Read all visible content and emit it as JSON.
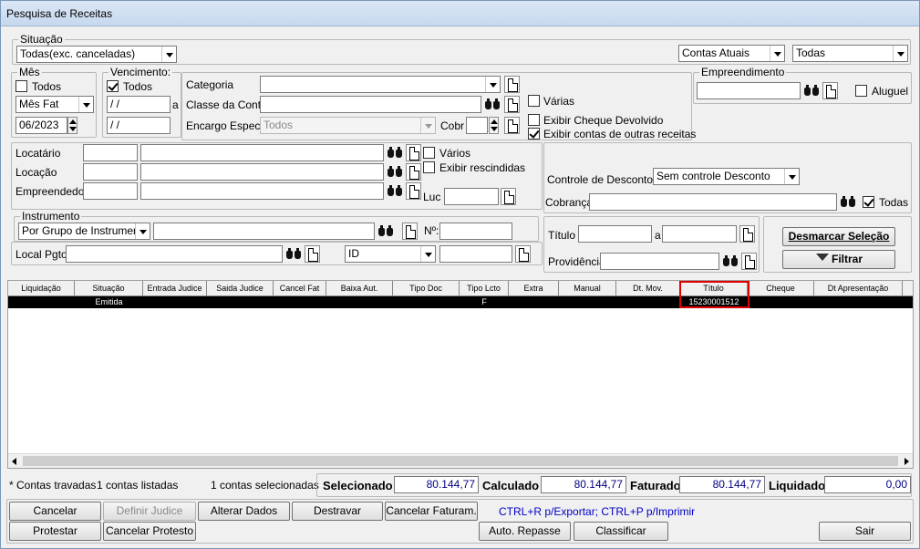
{
  "window": {
    "title": "Pesquisa de Receitas"
  },
  "situacao": {
    "legend": "Situação",
    "value": "Todas(exc. canceladas)"
  },
  "contas": {
    "value": "Contas Atuais"
  },
  "todas_combo": {
    "value": "Todas"
  },
  "mes": {
    "legend": "Mês",
    "todos_label": "Todos",
    "todos_checked": false,
    "tipo": "Mês Fat",
    "periodo": "06/2023"
  },
  "vencimento": {
    "legend": "Vencimento:",
    "todos_label": "Todos",
    "todos_checked": true,
    "de": " / /",
    "sep": "a",
    "ate": " / /"
  },
  "categoria": {
    "label": "Categoria",
    "value": ""
  },
  "classe": {
    "label": "Classe da Conta",
    "value": ""
  },
  "encargo": {
    "label": "Encargo Espec.",
    "value": "Todos"
  },
  "cobr": {
    "label": "Cobr",
    "value": ""
  },
  "opcoes": {
    "varias": "Várias",
    "cheque_devolvido": "Exibir Cheque Devolvido",
    "outras_receitas": "Exibir contas de outras receitas",
    "outras_receitas_checked": true
  },
  "empreendimento": {
    "legend": "Empreendimento",
    "value": "",
    "aluguel": "Aluguel"
  },
  "filtros": {
    "locatario": "Locatário",
    "locacao": "Locação",
    "empreendedor": "Empreendedor",
    "varios": "Vários",
    "rescindidas": "Exibir rescindidas",
    "luc": "Luc"
  },
  "descontos": {
    "label": "Controle de Descontos",
    "value": "Sem controle Desconto"
  },
  "cobranca": {
    "label": "Cobrança",
    "value": "",
    "todas": "Todas",
    "todas_checked": true
  },
  "instrumento": {
    "legend": "Instrumento",
    "value": "Por Grupo de Instrumento",
    "numero_label": "Nº:"
  },
  "local_pgto": {
    "label": "Local Pgto",
    "id_value": "ID"
  },
  "titulo": {
    "label": "Título",
    "sep": "a"
  },
  "providencia": {
    "label": "Providência"
  },
  "buttons": {
    "desmarcar": "Desmarcar Seleção",
    "filtrar": "Filtrar"
  },
  "grid": {
    "columns": [
      "Liquidação",
      "Situação",
      "Entrada Judice",
      "Saida Judice",
      "Cancel Fat",
      "Baixa Aut.",
      "Tipo Doc",
      "Tipo Lcto",
      "Extra",
      "Manual",
      "Dt. Mov.",
      "Título",
      "Cheque",
      "Dt Apresentação"
    ],
    "rows": [
      {
        "situacao": "Emitida",
        "tipo_lcto": "F",
        "titulo": "15230001512"
      }
    ]
  },
  "status": {
    "travadas": "* Contas travadas",
    "listadas": "1 contas listadas",
    "selecionadas": "1 contas selecionadas"
  },
  "totais": {
    "selecionado_label": "Selecionado",
    "selecionado": "80.144,77",
    "calculado_label": "Calculado",
    "calculado": "80.144,77",
    "faturado_label": "Faturado",
    "faturado": "80.144,77",
    "liquidado_label": "Liquidado",
    "liquidado": "0,00"
  },
  "actions": {
    "cancelar": "Cancelar",
    "definir_judice": "Definir Judice",
    "alterar_dados": "Alterar Dados",
    "destravar": "Destravar",
    "cancelar_faturam": "Cancelar Faturam.",
    "hint": "CTRL+R p/Exportar; CTRL+P p/Imprimir",
    "protestar": "Protestar",
    "cancelar_protesto": "Cancelar Protesto",
    "auto_repasse": "Auto. Repasse",
    "classificar": "Classificar",
    "sair": "Sair"
  }
}
